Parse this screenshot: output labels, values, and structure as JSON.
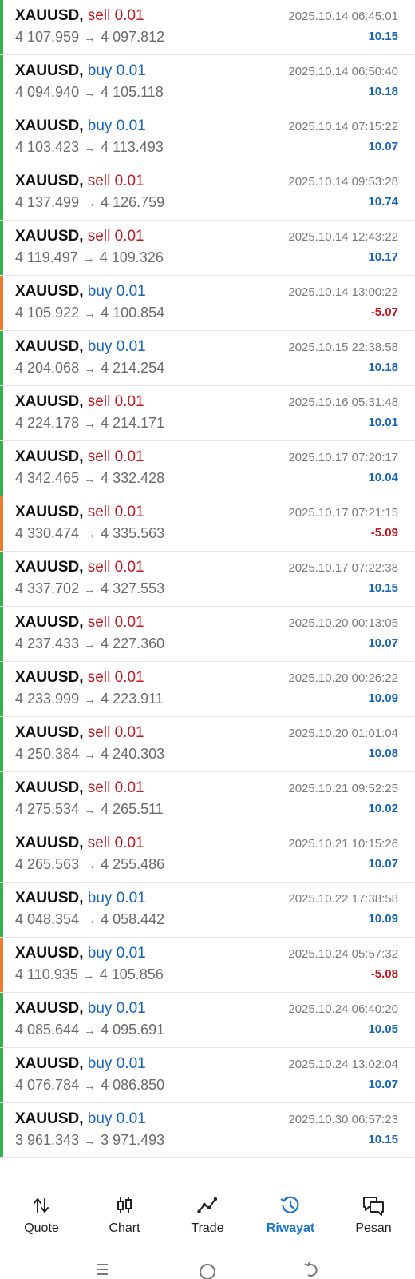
{
  "trades": [
    {
      "symbol": "XAUUSD",
      "side": "sell",
      "volume": "0.01",
      "open_price": "4 107.959",
      "close_price": "4 097.812",
      "time": "2025.10.14 06:45:01",
      "profit": "10.15",
      "result": "profit"
    },
    {
      "symbol": "XAUUSD",
      "side": "buy",
      "volume": "0.01",
      "open_price": "4 094.940",
      "close_price": "4 105.118",
      "time": "2025.10.14 06:50:40",
      "profit": "10.18",
      "result": "profit"
    },
    {
      "symbol": "XAUUSD",
      "side": "buy",
      "volume": "0.01",
      "open_price": "4 103.423",
      "close_price": "4 113.493",
      "time": "2025.10.14 07:15:22",
      "profit": "10.07",
      "result": "profit"
    },
    {
      "symbol": "XAUUSD",
      "side": "sell",
      "volume": "0.01",
      "open_price": "4 137.499",
      "close_price": "4 126.759",
      "time": "2025.10.14 09:53:28",
      "profit": "10.74",
      "result": "profit"
    },
    {
      "symbol": "XAUUSD",
      "side": "sell",
      "volume": "0.01",
      "open_price": "4 119.497",
      "close_price": "4 109.326",
      "time": "2025.10.14 12:43:22",
      "profit": "10.17",
      "result": "profit"
    },
    {
      "symbol": "XAUUSD",
      "side": "buy",
      "volume": "0.01",
      "open_price": "4 105.922",
      "close_price": "4 100.854",
      "time": "2025.10.14 13:00:22",
      "profit": "-5.07",
      "result": "loss"
    },
    {
      "symbol": "XAUUSD",
      "side": "buy",
      "volume": "0.01",
      "open_price": "4 204.068",
      "close_price": "4 214.254",
      "time": "2025.10.15 22:38:58",
      "profit": "10.18",
      "result": "profit"
    },
    {
      "symbol": "XAUUSD",
      "side": "sell",
      "volume": "0.01",
      "open_price": "4 224.178",
      "close_price": "4 214.171",
      "time": "2025.10.16 05:31:48",
      "profit": "10.01",
      "result": "profit"
    },
    {
      "symbol": "XAUUSD",
      "side": "sell",
      "volume": "0.01",
      "open_price": "4 342.465",
      "close_price": "4 332.428",
      "time": "2025.10.17 07:20:17",
      "profit": "10.04",
      "result": "profit"
    },
    {
      "symbol": "XAUUSD",
      "side": "sell",
      "volume": "0.01",
      "open_price": "4 330.474",
      "close_price": "4 335.563",
      "time": "2025.10.17 07:21:15",
      "profit": "-5.09",
      "result": "loss"
    },
    {
      "symbol": "XAUUSD",
      "side": "sell",
      "volume": "0.01",
      "open_price": "4 337.702",
      "close_price": "4 327.553",
      "time": "2025.10.17 07:22:38",
      "profit": "10.15",
      "result": "profit"
    },
    {
      "symbol": "XAUUSD",
      "side": "sell",
      "volume": "0.01",
      "open_price": "4 237.433",
      "close_price": "4 227.360",
      "time": "2025.10.20 00:13:05",
      "profit": "10.07",
      "result": "profit"
    },
    {
      "symbol": "XAUUSD",
      "side": "sell",
      "volume": "0.01",
      "open_price": "4 233.999",
      "close_price": "4 223.911",
      "time": "2025.10.20 00:26:22",
      "profit": "10.09",
      "result": "profit"
    },
    {
      "symbol": "XAUUSD",
      "side": "sell",
      "volume": "0.01",
      "open_price": "4 250.384",
      "close_price": "4 240.303",
      "time": "2025.10.20 01:01:04",
      "profit": "10.08",
      "result": "profit"
    },
    {
      "symbol": "XAUUSD",
      "side": "sell",
      "volume": "0.01",
      "open_price": "4 275.534",
      "close_price": "4 265.511",
      "time": "2025.10.21 09:52:25",
      "profit": "10.02",
      "result": "profit"
    },
    {
      "symbol": "XAUUSD",
      "side": "sell",
      "volume": "0.01",
      "open_price": "4 265.563",
      "close_price": "4 255.486",
      "time": "2025.10.21 10:15:26",
      "profit": "10.07",
      "result": "profit"
    },
    {
      "symbol": "XAUUSD",
      "side": "buy",
      "volume": "0.01",
      "open_price": "4 048.354",
      "close_price": "4 058.442",
      "time": "2025.10.22 17:38:58",
      "profit": "10.09",
      "result": "profit"
    },
    {
      "symbol": "XAUUSD",
      "side": "buy",
      "volume": "0.01",
      "open_price": "4 110.935",
      "close_price": "4 105.856",
      "time": "2025.10.24 05:57:32",
      "profit": "-5.08",
      "result": "loss"
    },
    {
      "symbol": "XAUUSD",
      "side": "buy",
      "volume": "0.01",
      "open_price": "4 085.644",
      "close_price": "4 095.691",
      "time": "2025.10.24 06:40:20",
      "profit": "10.05",
      "result": "profit"
    },
    {
      "symbol": "XAUUSD",
      "side": "buy",
      "volume": "0.01",
      "open_price": "4 076.784",
      "close_price": "4 086.850",
      "time": "2025.10.24 13:02:04",
      "profit": "10.07",
      "result": "profit"
    },
    {
      "symbol": "XAUUSD",
      "side": "buy",
      "volume": "0.01",
      "open_price": "3 961.343",
      "close_price": "3 971.493",
      "time": "2025.10.30 06:57:23",
      "profit": "10.15",
      "result": "profit"
    }
  ],
  "nav": {
    "items": [
      {
        "label": "Quote",
        "icon": "quote-arrows-icon"
      },
      {
        "label": "Chart",
        "icon": "candlestick-icon"
      },
      {
        "label": "Trade",
        "icon": "trade-line-icon"
      },
      {
        "label": "Riwayat",
        "icon": "history-clock-icon"
      },
      {
        "label": "Pesan",
        "icon": "messages-icon"
      }
    ],
    "active": "Riwayat"
  },
  "system_nav": [
    "recent-apps-icon",
    "home-icon",
    "back-icon"
  ],
  "colors": {
    "sell": "#c8171e",
    "buy": "#1565c0",
    "profit_positive": "#1565c0",
    "profit_negative": "#c8171e",
    "marker_profit": "#2fb34a",
    "marker_loss": "#f07a2c",
    "nav_active": "#1976d2"
  }
}
